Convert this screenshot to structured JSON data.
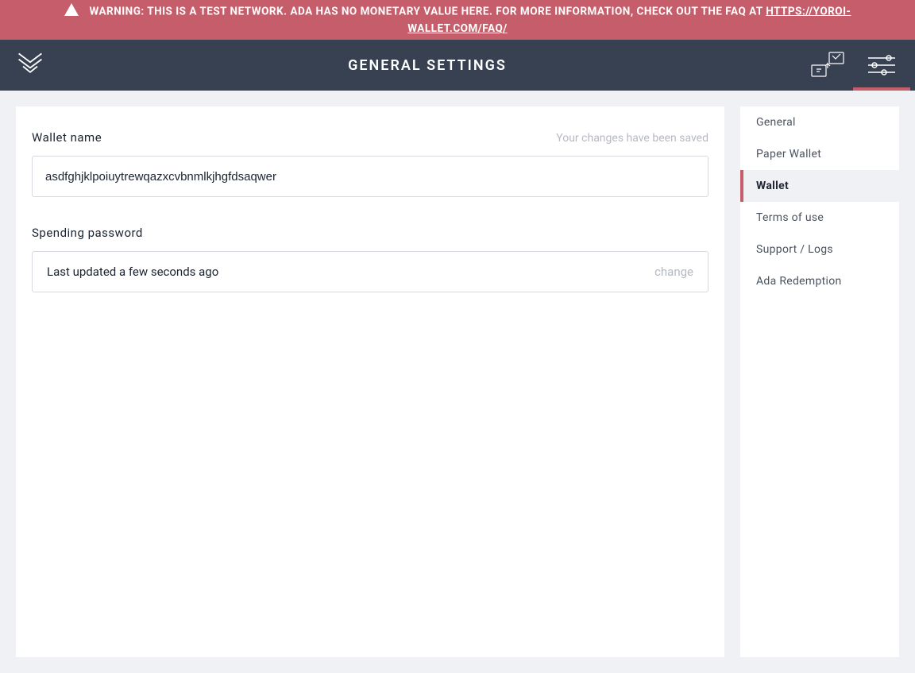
{
  "warning": {
    "prefix": "WARNING: THIS IS A TEST NETWORK. ADA HAS NO MONETARY VALUE HERE. FOR MORE INFORMATION, CHECK OUT THE FAQ AT ",
    "link": "HTTPS://YOROI-WALLET.COM/FAQ/"
  },
  "header": {
    "title": "GENERAL SETTINGS"
  },
  "wallet_name": {
    "label": "Wallet name",
    "saved_hint": "Your changes have been saved",
    "value": "asdfghjklpoiuytrewqazxcvbnmlkjhgfdsaqwer"
  },
  "spending_password": {
    "label": "Spending password",
    "status": "Last updated a few seconds ago",
    "change_label": "change"
  },
  "sidebar": {
    "items": [
      {
        "label": "General"
      },
      {
        "label": "Paper Wallet"
      },
      {
        "label": "Wallet"
      },
      {
        "label": "Terms of use"
      },
      {
        "label": "Support / Logs"
      },
      {
        "label": "Ada Redemption"
      }
    ],
    "active_index": 2
  }
}
